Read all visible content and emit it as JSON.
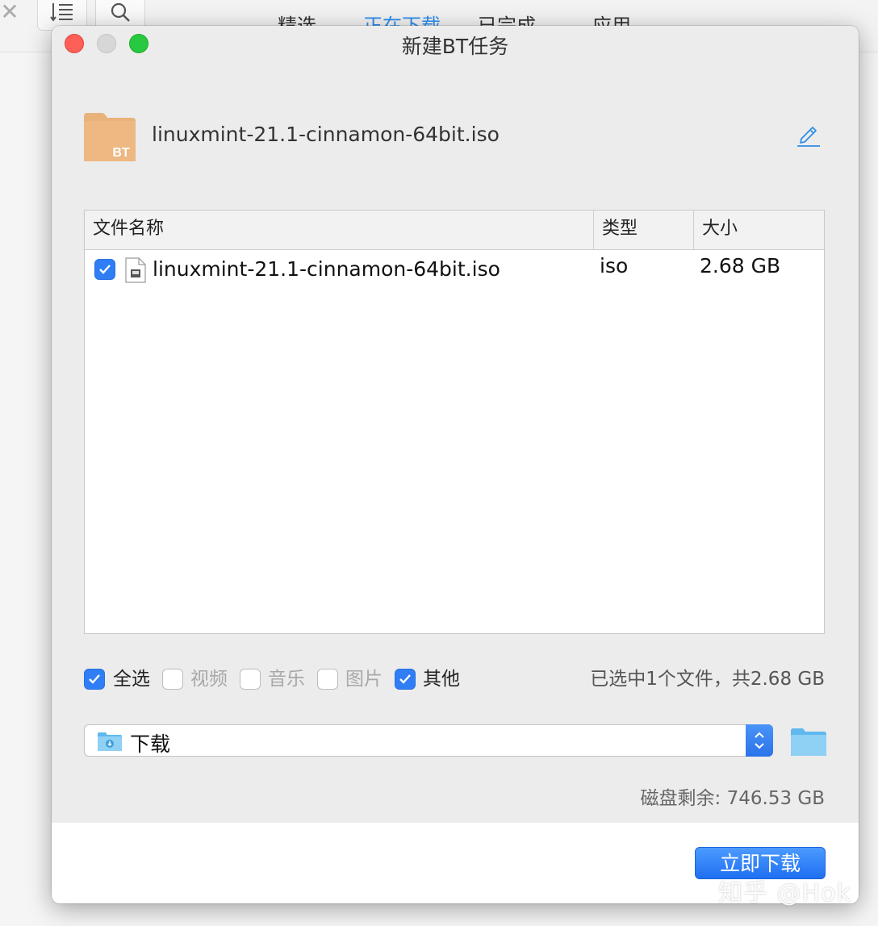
{
  "background_app": {
    "toolbar_icons": [
      "close-icon",
      "sort-list-icon",
      "search-icon"
    ],
    "tabs": [
      {
        "label": "精选",
        "active": false
      },
      {
        "label": "正在下载",
        "active": true
      },
      {
        "label": "已完成",
        "active": false
      },
      {
        "label": "应用",
        "active": false
      }
    ],
    "accent_color": "#2a8cf0"
  },
  "dialog": {
    "title": "新建BT任务",
    "task": {
      "icon_label": "BT",
      "name": "linuxmint-21.1-cinnamon-64bit.iso",
      "edit_icon": "pencil-icon"
    },
    "table": {
      "headers": {
        "name": "文件名称",
        "type": "类型",
        "size": "大小"
      },
      "rows": [
        {
          "checked": true,
          "name": "linuxmint-21.1-cinnamon-64bit.iso",
          "type": "iso",
          "size": "2.68 GB"
        }
      ]
    },
    "filters": [
      {
        "label": "全选",
        "checked": true,
        "enabled": true
      },
      {
        "label": "视频",
        "checked": false,
        "enabled": false
      },
      {
        "label": "音乐",
        "checked": false,
        "enabled": false
      },
      {
        "label": "图片",
        "checked": false,
        "enabled": false
      },
      {
        "label": "其他",
        "checked": true,
        "enabled": true
      }
    ],
    "selection_summary": "已选中1个文件，共2.68 GB",
    "save_path": "下载",
    "disk_free": "磁盘剩余: 746.53 GB",
    "download_button": "立即下载"
  },
  "watermark": "知乎 @Hok",
  "colors": {
    "checkbox": "#2f7ef5",
    "button": "#1f6ff2",
    "folder_tan": "#e9b27a",
    "folder_blue": "#6cc3f2"
  }
}
